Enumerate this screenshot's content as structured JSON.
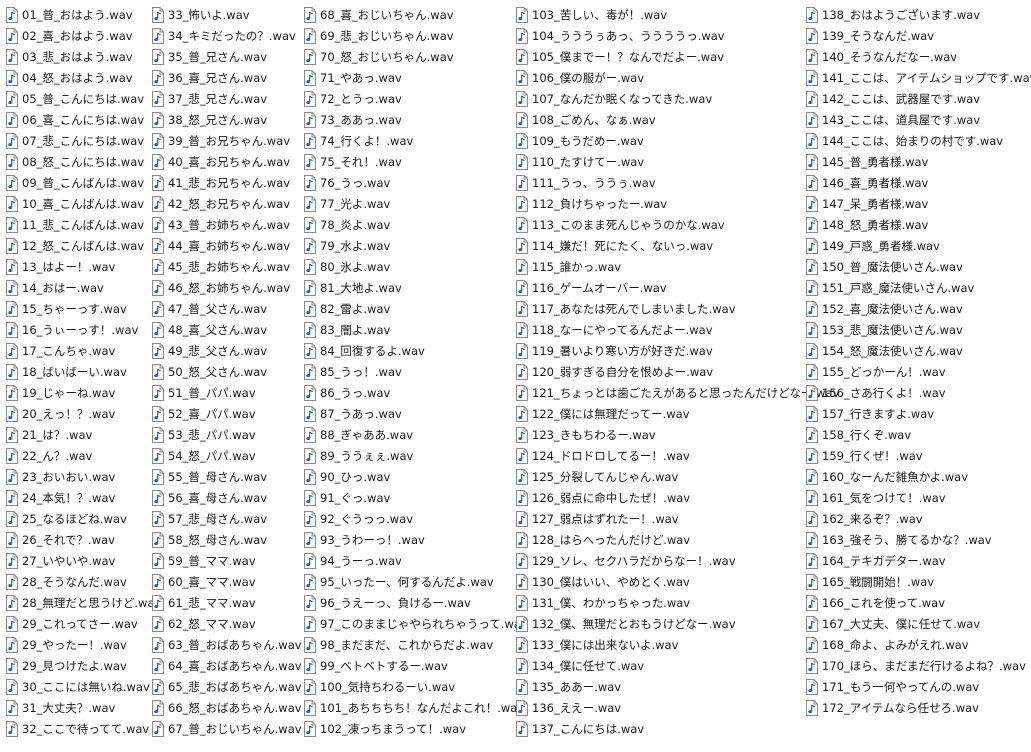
{
  "icon": "audio-wav-file-icon",
  "colors": {
    "icon_border": "#8a8a8a",
    "icon_fill": "#ffffff",
    "note_color": "#1f5fb5",
    "text": "#1a1a1a",
    "background": "#ffffff"
  },
  "columns": [
    {
      "files": [
        "01_普_おはよう.wav",
        "02_喜_おはよう.wav",
        "03_悲_おはよう.wav",
        "04_怒_おはよう.wav",
        "05_普_こんにちは.wav",
        "06_喜_こんにちは.wav",
        "07_悲_こんにちは.wav",
        "08_怒_こんにちは.wav",
        "09_普_こんばんは.wav",
        "10_喜_こんばんは.wav",
        "11_悲_こんばんは.wav",
        "12_怒_こんばんは.wav",
        "13_はよー！.wav",
        "14_おはー.wav",
        "15_ちゃーっす.wav",
        "16_うぃーっす！.wav",
        "17_こんちゃ.wav",
        "18_ばいばーい.wav",
        "19_じゃーね.wav",
        "20_えっ！？.wav",
        "21_は？.wav",
        "22_ん？.wav",
        "23_おいおい.wav",
        "24_本気！？.wav",
        "25_なるほどね.wav",
        "26_それで？.wav",
        "27_いやいや.wav",
        "28_そうなんだ.wav",
        "28_無理だと思うけど.wav",
        "29_これってさー.wav",
        "29_やったー！.wav",
        "29_見つけたよ.wav",
        "30_ここには無いね.wav",
        "31_大丈夫？.wav",
        "32_ここで待ってて.wav"
      ]
    },
    {
      "files": [
        "33_怖いよ.wav",
        "34_キミだったの？.wav",
        "35_普_兄さん.wav",
        "36_喜_兄さん.wav",
        "37_悲_兄さん.wav",
        "38_怒_兄さん.wav",
        "39_普_お兄ちゃん.wav",
        "40_喜_お兄ちゃん.wav",
        "41_悲_お兄ちゃん.wav",
        "42_怒_お兄ちゃん.wav",
        "43_普_お姉ちゃん.wav",
        "44_喜_お姉ちゃん.wav",
        "45_悲_お姉ちゃん.wav",
        "46_怒_お姉ちゃん.wav",
        "47_普_父さん.wav",
        "48_喜_父さん.wav",
        "49_悲_父さん.wav",
        "50_怒_父さん.wav",
        "51_普_パパ.wav",
        "52_喜_パパ.wav",
        "53_悲_パパ.wav",
        "54_怒_パパ.wav",
        "55_普_母さん.wav",
        "56_喜_母さん.wav",
        "57_悲_母さん.wav",
        "58_怒_母さん.wav",
        "59_普_ママ.wav",
        "60_喜_ママ.wav",
        "61_悲_ママ.wav",
        "62_怒_ママ.wav",
        "63_普_おばあちゃん.wav",
        "64_喜_おばあちゃん.wav",
        "65_悲_おばあちゃん.wav",
        "66_怒_おばあちゃん.wav",
        "67_普_おじいちゃん.wav"
      ]
    },
    {
      "files": [
        "68_喜_おじいちゃん.wav",
        "69_悲_おじいちゃん.wav",
        "70_怒_おじいちゃん.wav",
        "71_やあっ.wav",
        "72_とうっ.wav",
        "73_ああっ.wav",
        "74_行くよ！.wav",
        "75_それ！.wav",
        "76_うっ.wav",
        "77_光よ.wav",
        "78_炎よ.wav",
        "79_水よ.wav",
        "80_氷よ.wav",
        "81_大地よ.wav",
        "82_雷よ.wav",
        "83_闇よ.wav",
        "84_回復するよ.wav",
        "85_うっ！.wav",
        "86_うっ.wav",
        "87_うあっ.wav",
        "88_ぎゃああ.wav",
        "89_ううぇぇ.wav",
        "90_ひっ.wav",
        "91_ぐっ.wav",
        "92_ぐうっっ.wav",
        "93_うわーっ！.wav",
        "94_うーっ.wav",
        "95_いったー、何するんだよ.wav",
        "96_うえーっ、負けるー.wav",
        "97_このままじゃやられちゃうって.wav",
        "98_まだまだ、これからだよ.wav",
        "99_ベトベトするー.wav",
        "100_気持ちわるーい.wav",
        "101_あちちちち！なんだよこれ！.wav",
        "102_凍っちまうって！.wav"
      ]
    },
    {
      "files": [
        "103_苦しい、毒が！.wav",
        "104_うううぅあっ、ううううっ.wav",
        "105_僕までー！？なんでだよー.wav",
        "106_僕の服がー.wav",
        "107_なんだか眠くなってきた.wav",
        "108_ごめん、なぁ.wav",
        "109_もうだめー.wav",
        "110_たすけてー.wav",
        "111_うっ、ううぅ.wav",
        "112_負けちゃったー.wav",
        "113_このまま死んじゃうのかな.wav",
        "114_嫌だ！死にたく、ないっ.wav",
        "115_誰かっ.wav",
        "116_ゲームオーバー.wav",
        "117_あなたは死んでしまいました.wav",
        "118_なーにやってるんだよー.wav",
        "119_暑いより寒い方が好きだ.wav",
        "120_弱すぎる自分を恨めよー.wav",
        "121_ちょっとは歯ごたえがあると思ったんだけどなー.wav",
        "122_僕には無理だってー.wav",
        "123_きもちわるー.wav",
        "124_ドロドロしてるー！.wav",
        "125_分裂してんじゃん.wav",
        "126_弱点に命中したぜ！.wav",
        "127_弱点はずれたー！.wav",
        "128_はらへったんだけど.wav",
        "129_ソレ、セクハラだからなー！.wav",
        "130_僕はいい、やめとく.wav",
        "131_僕、わかっちゃった.wav",
        "132_僕、無理だとおもうけどなー.wav",
        "133_僕には出来ないよ.wav",
        "134_僕に任せて.wav",
        "135_ああー.wav",
        "136_ええー.wav",
        "137_こんにちは.wav"
      ]
    },
    {
      "files": [
        "138_おはようございます.wav",
        "139_そうなんだ.wav",
        "140_そうなんだなー.wav",
        "141_ここは、アイテムショップです.wav",
        "142_ここは、武器屋です.wav",
        "143_ここは、道具屋です.wav",
        "144_ここは、始まりの村です.wav",
        "145_普_勇者様.wav",
        "146_喜_勇者様.wav",
        "147_呆_勇者様.wav",
        "148_怒_勇者様.wav",
        "149_戸惑_勇者様.wav",
        "150_普_魔法使いさん.wav",
        "151_戸惑_魔法使いさん.wav",
        "152_喜_魔法使いさん.wav",
        "153_悲_魔法使いさん.wav",
        "154_怒_魔法使いさん.wav",
        "155_どっかーん！.wav",
        "156_さあ行くよ！.wav",
        "157_行きますよ.wav",
        "158_行くぞ.wav",
        "159_行くぜ！.wav",
        "160_なーんだ雑魚かよ.wav",
        "161_気をつけて！.wav",
        "162_来るぞ？.wav",
        "163_強そう、勝てるかな？.wav",
        "164_テキガデター.wav",
        "165_戦闘開始！.wav",
        "166_これを使って.wav",
        "167_大丈夫、僕に任せて.wav",
        "168_命よ、よみがえれ.wav",
        "170_ほら、まだまだ行けるよね？.wav",
        "171_もう一何やってんの.wav",
        "172_アイテムなら任せろ.wav"
      ]
    }
  ]
}
